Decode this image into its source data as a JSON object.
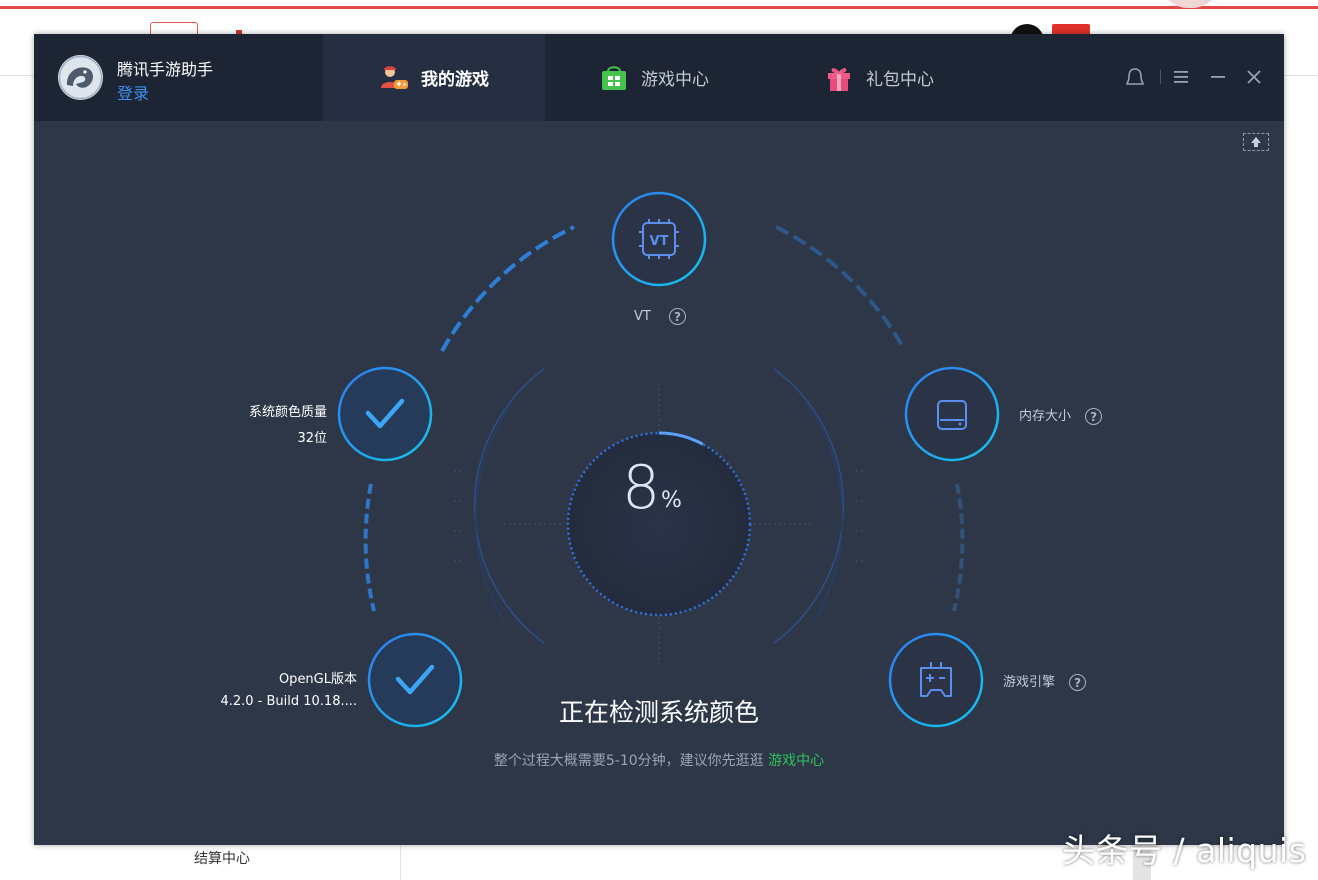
{
  "app": {
    "name": "腾讯手游助手",
    "login": "登录"
  },
  "tabs": [
    {
      "label": "我的游戏",
      "active": true,
      "icon": "player-controller-icon"
    },
    {
      "label": "游戏中心",
      "active": false,
      "icon": "shopping-bag-icon"
    },
    {
      "label": "礼包中心",
      "active": false,
      "icon": "gift-icon"
    }
  ],
  "controls": [
    "skin-icon",
    "menu-icon",
    "minimize-icon",
    "close-icon"
  ],
  "detection": {
    "progress_percent": 8,
    "progress_text": "8",
    "percent_sign": "%",
    "items": [
      {
        "id": "vt",
        "label": "VT",
        "state": "pending",
        "icon": "vt-chip-icon"
      },
      {
        "id": "memory",
        "label": "内存大小",
        "state": "pending",
        "icon": "memory-card-icon"
      },
      {
        "id": "engine",
        "label": "游戏引擎",
        "state": "pending",
        "icon": "gamepad-icon"
      },
      {
        "id": "color",
        "label": "系统颜色质量",
        "value": "32位",
        "state": "done",
        "icon": "checkmark-icon"
      },
      {
        "id": "opengl",
        "label": "OpenGL版本",
        "value": "4.2.0 - Build 10.18....",
        "state": "done",
        "icon": "checkmark-icon"
      }
    ],
    "status": "正在检测系统颜色",
    "hint_prefix": "整个过程大概需要5-10分钟，建议你先逛逛",
    "hint_link": "游戏中心"
  },
  "background": {
    "footer_item": "结算中心",
    "watermark": "头条号 / aliquis"
  },
  "colors": {
    "accent_blue": "#1aa4ee",
    "link_blue": "#3e8ff1",
    "link_green": "#2fc35a",
    "window_bg": "#2d3748",
    "titlebar_bg": "#1d2535"
  }
}
